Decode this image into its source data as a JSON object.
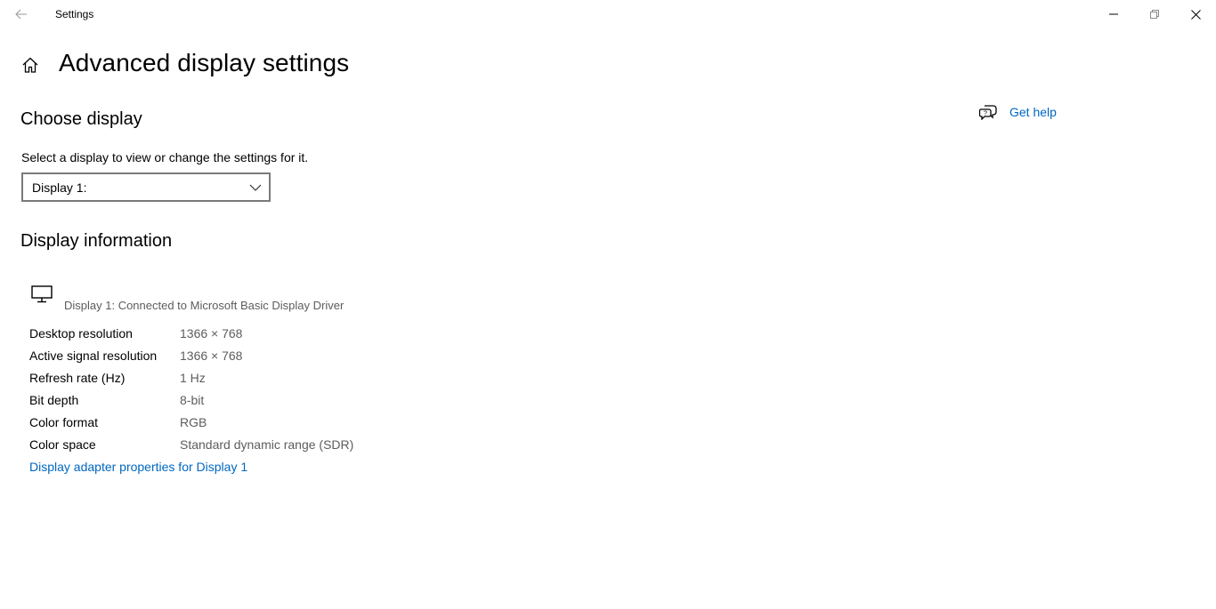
{
  "window": {
    "app_title": "Settings",
    "back_icon": "back-arrow-icon",
    "minimize_icon": "minimize-icon",
    "restore_icon": "restore-icon",
    "close_icon": "close-icon"
  },
  "header": {
    "home_icon": "home-icon",
    "title": "Advanced display settings"
  },
  "choose_display": {
    "heading": "Choose display",
    "description": "Select a display to view or change the settings for it.",
    "selected_value": "Display 1:",
    "chevron_icon": "chevron-down-icon"
  },
  "display_information": {
    "heading": "Display information",
    "monitor_icon": "monitor-icon",
    "subtitle": "Display 1: Connected to Microsoft Basic Display Driver",
    "rows": [
      {
        "label": "Desktop resolution",
        "value": "1366 × 768"
      },
      {
        "label": "Active signal resolution",
        "value": "1366 × 768"
      },
      {
        "label": "Refresh rate (Hz)",
        "value": "1 Hz"
      },
      {
        "label": "Bit depth",
        "value": "8-bit"
      },
      {
        "label": "Color format",
        "value": "RGB"
      },
      {
        "label": "Color space",
        "value": "Standard dynamic range (SDR)"
      }
    ],
    "adapter_link": "Display adapter properties for Display 1"
  },
  "help": {
    "icon": "help-chat-icon",
    "label": "Get help"
  },
  "colors": {
    "accent": "#0067c0",
    "secondary_text": "#5d5d5d",
    "background": "#ffffff"
  }
}
